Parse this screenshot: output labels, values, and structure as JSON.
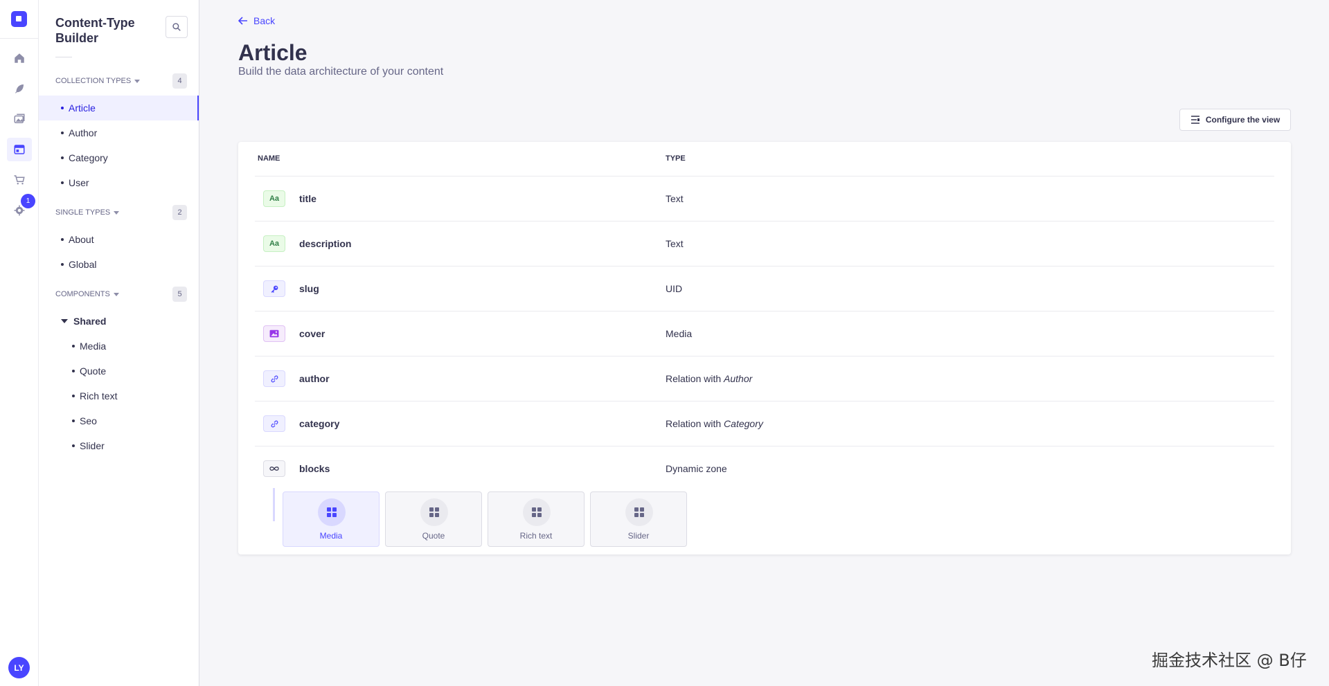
{
  "rail": {
    "notification_count": "1",
    "avatar_initials": "LY"
  },
  "subnav": {
    "title": "Content-Type Builder",
    "sections": {
      "collection": {
        "label": "COLLECTION TYPES",
        "count": "4",
        "items": [
          "Article",
          "Author",
          "Category",
          "User"
        ]
      },
      "single": {
        "label": "SINGLE TYPES",
        "count": "2",
        "items": [
          "About",
          "Global"
        ]
      },
      "components": {
        "label": "COMPONENTS",
        "count": "5",
        "group": "Shared",
        "items": [
          "Media",
          "Quote",
          "Rich text",
          "Seo",
          "Slider"
        ]
      }
    }
  },
  "header": {
    "back_label": "Back",
    "title": "Article",
    "subtitle": "Build the data architecture of your content",
    "configure_label": "Configure the view"
  },
  "table": {
    "columns": [
      "NAME",
      "TYPE"
    ],
    "rows": [
      {
        "icon": "Aa",
        "name": "title",
        "type": "Text",
        "rel": ""
      },
      {
        "icon": "Aa",
        "name": "description",
        "type": "Text",
        "rel": ""
      },
      {
        "icon": "key-icon",
        "name": "slug",
        "type": "UID",
        "rel": ""
      },
      {
        "icon": "image-icon",
        "name": "cover",
        "type": "Media",
        "rel": ""
      },
      {
        "icon": "link-icon",
        "name": "author",
        "type": "Relation with ",
        "rel": "Author"
      },
      {
        "icon": "link-icon",
        "name": "category",
        "type": "Relation with ",
        "rel": "Category"
      },
      {
        "icon": "infinity-icon",
        "name": "blocks",
        "type": "Dynamic zone",
        "rel": ""
      }
    ],
    "dynamic_zone_components": [
      "Media",
      "Quote",
      "Rich text",
      "Slider"
    ]
  },
  "watermark": "掘金技术社区 @ B仔",
  "colors": {
    "primary": "#4945ff",
    "text": "#32324d",
    "muted": "#666687"
  }
}
